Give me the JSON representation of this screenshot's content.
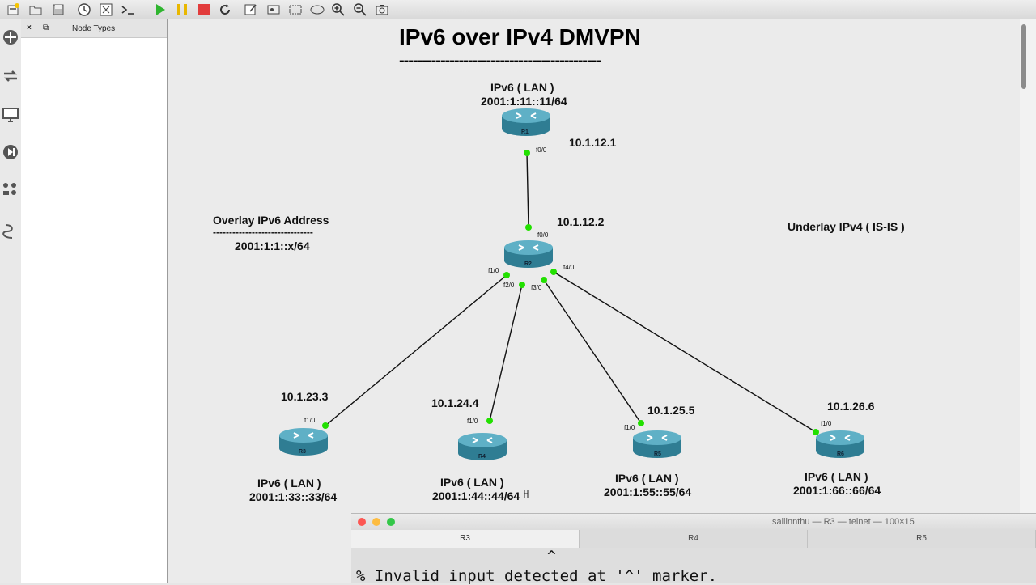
{
  "toolbar": {
    "buttons": [
      "new-project",
      "open-project",
      "save-project",
      "snapshot",
      "console",
      "terminal",
      "start",
      "pause",
      "stop",
      "reload",
      "annotate",
      "image",
      "rectangle",
      "ellipse",
      "zoom-in",
      "zoom-out",
      "screenshot"
    ]
  },
  "sidebar": {
    "icons": [
      "routers-icon",
      "switches-icon",
      "end-devices-icon",
      "security-icon",
      "all-devices-icon",
      "link-icon"
    ]
  },
  "dock": {
    "close": "×",
    "float": "⧉",
    "title": "Node Types"
  },
  "canvas": {
    "title": "IPv6 over IPv4 DMVPN",
    "title_underline": "--------------------------------------------",
    "overlay": {
      "heading": "Overlay IPv6 Address",
      "dashes": "-------------------------------",
      "value": "2001:1:1::x/64"
    },
    "underlay": "Underlay IPv4 ( IS-IS )",
    "routers": {
      "r1": {
        "name": "R1",
        "lan": "IPv6 ( LAN )",
        "prefix": "2001:1:11::11/64",
        "ip": "10.1.12.1",
        "iface": "f0/0"
      },
      "r2": {
        "name": "R2",
        "ip": "10.1.12.2",
        "iface_up": "f0/0",
        "iface1": "f1/0",
        "iface2": "f2/0",
        "iface3": "f3/0",
        "iface4": "f4/0"
      },
      "r3": {
        "name": "R3",
        "lan": "IPv6 ( LAN )",
        "prefix": "2001:1:33::33/64",
        "ip": "10.1.23.3",
        "iface": "f1/0"
      },
      "r4": {
        "name": "R4",
        "lan": "IPv6 ( LAN )",
        "prefix": "2001:1:44::44/64",
        "ip": "10.1.24.4",
        "iface": "f1/0"
      },
      "r5": {
        "name": "R5",
        "lan": "IPv6 ( LAN )",
        "prefix": "2001:1:55::55/64",
        "ip": "10.1.25.5",
        "iface": "f1/0"
      },
      "r6": {
        "name": "R6",
        "lan": "IPv6 ( LAN )",
        "prefix": "2001:1:66::66/64",
        "ip": "10.1.26.6",
        "iface": "f1/0"
      }
    }
  },
  "terminal": {
    "title": "sailinnthu — R3 — telnet — 100×15",
    "tabs": [
      "R3",
      "R4",
      "R5"
    ],
    "caret": "^",
    "output": "% Invalid input detected at '^' marker."
  },
  "colors": {
    "link_up": "#22e000",
    "router_body": "#3a8fa6",
    "close": "#fc5753",
    "minimize": "#fdbc40",
    "maximize": "#33c748"
  }
}
